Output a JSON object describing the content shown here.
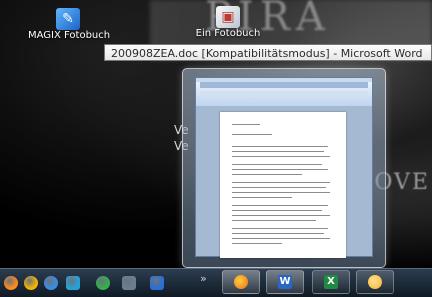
{
  "desktop": {
    "icons": [
      {
        "label": "MAGIX Fotobuch",
        "icon": "magix-fotobuch-icon"
      },
      {
        "label": "Ein Fotobuch",
        "icon": "shortcut-icon"
      }
    ],
    "background_fragments": [
      "Ve",
      "Ve",
      "OVE"
    ]
  },
  "tooltip": {
    "text": "200908ZEA.doc [Kompatibilitätsmodus] - Microsoft Word"
  },
  "taskbar": {
    "pinned": [
      {
        "icon": "start-orb-icon",
        "color": "#ff8c1a"
      },
      {
        "icon": "media-player-icon",
        "color": "#f5b400"
      },
      {
        "icon": "browser-icon",
        "color": "#3a8ee6"
      },
      {
        "icon": "explorer-icon",
        "color": "#27a2d9"
      },
      {
        "icon": "green-app-icon",
        "color": "#2fb24c"
      },
      {
        "icon": "calendar-icon",
        "color": "#6a7f93"
      },
      {
        "icon": "ie-icon",
        "color": "#2a6fd6"
      }
    ],
    "overflow_chevron": "»",
    "buttons": [
      {
        "icon": "firefox-icon",
        "color": "#e86b1f",
        "glyph": ""
      },
      {
        "icon": "word-icon",
        "color": "#2b66c2",
        "glyph": "W"
      },
      {
        "icon": "excel-icon",
        "color": "#1f8a43",
        "glyph": "X"
      },
      {
        "icon": "chat-icon",
        "color": "#f2b53a",
        "glyph": ""
      }
    ]
  }
}
